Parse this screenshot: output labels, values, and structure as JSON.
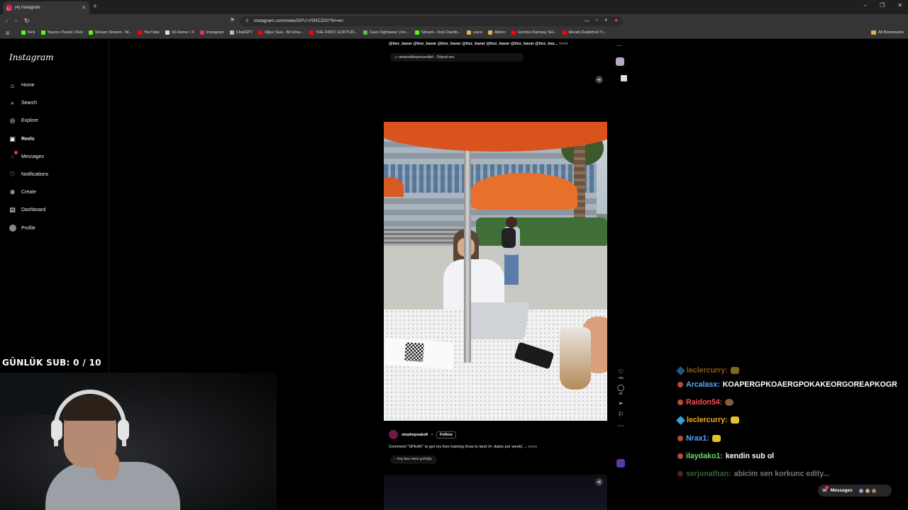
{
  "browser": {
    "tab_title": "(4) Instagram",
    "new_tab_glyph": "+",
    "url": "instagram.com/reels/DPU-VSRCZtX/?hl=en",
    "window_controls": [
      "–",
      "❐",
      "✕"
    ],
    "bookmarks": [
      {
        "label": "Kick",
        "color": "#53fc18"
      },
      {
        "label": "Yayıncı Paneli | Kick",
        "color": "#53fc18"
      },
      {
        "label": "İkinsan Stream - W...",
        "color": "#53fc18"
      },
      {
        "label": "YouTube",
        "color": "#ff0000"
      },
      {
        "label": "(4) Home / X",
        "color": "#dddddd"
      },
      {
        "label": "Instagram",
        "color": "#e1306c"
      },
      {
        "label": "ChatGPT",
        "color": "#bbbbbb"
      },
      {
        "label": "Oğuz Sasi - Bir Efsa...",
        "color": "#ff0000"
      },
      {
        "label": "THE FIRST GOKTUR...",
        "color": "#ff0000"
      },
      {
        "label": "Cave Fightwear | Ins...",
        "color": "#53c24a"
      },
      {
        "label": "Stream - Kick Dashb...",
        "color": "#53fc18"
      },
      {
        "label": "yayın",
        "color": "#e0b050"
      },
      {
        "label": "Albüm",
        "color": "#e0b050"
      },
      {
        "label": "Gordon Ramsay SH...",
        "color": "#ff0000"
      },
      {
        "label": "Merab Dvalishvili Tr...",
        "color": "#ff0000"
      }
    ],
    "all_bookmarks": "All Bookmarks"
  },
  "instagram": {
    "logo": "Instagram",
    "nav": [
      {
        "label": "Home",
        "icon": "home-icon",
        "glyph": "⌂"
      },
      {
        "label": "Search",
        "icon": "search-icon",
        "glyph": "⌕"
      },
      {
        "label": "Explore",
        "icon": "compass-icon",
        "glyph": "◎"
      },
      {
        "label": "Reels",
        "icon": "reels-icon",
        "glyph": "▣"
      },
      {
        "label": "Messages",
        "icon": "messenger-icon",
        "glyph": "◌"
      },
      {
        "label": "Notifications",
        "icon": "heart-icon",
        "glyph": "♡"
      },
      {
        "label": "Create",
        "icon": "plus-square-icon",
        "glyph": "⊕"
      },
      {
        "label": "Dashboard",
        "icon": "dashboard-icon",
        "glyph": "▤"
      },
      {
        "label": "Profile",
        "icon": "profile-avatar-icon",
        "glyph": ""
      }
    ],
    "active_nav": "Reels"
  },
  "reel_previous": {
    "caption": "@tioz_bazar @tioz_bazar @tioz_bazar @tioz_bazar @tioz_bazar @tioz_bazar @tioz_baz...",
    "more": "more",
    "audio": "♫ campoalidepressedkid · Orijinal ses"
  },
  "reel_current": {
    "likes": "700",
    "comments": "20",
    "username": "stephspeaks8",
    "separator": "•",
    "follow": "Follow",
    "caption": "Comment \"SPEAK\" to get my free training (how to land 3+ dates per week) ...",
    "more": "more",
    "audio": "◦◦ Ray-Ban Meta gözlüğü"
  },
  "overlay": {
    "sub_counter": "GÜNLÜK SUB: 0 / 10"
  },
  "chat": [
    {
      "user": "leclercurry:",
      "color": "#f5a623",
      "message": "",
      "emote": true
    },
    {
      "user": "Arcalasx:",
      "color": "#5aa8ff",
      "message": "KOAPERGPKOAERGPOKAKEORGOREAPKOGR",
      "emote": false
    },
    {
      "user": "Raidon54:",
      "color": "#ff4d4d",
      "message": "",
      "emote": true
    },
    {
      "user": "leclercurry:",
      "color": "#f5a623",
      "message": "",
      "emote": true
    },
    {
      "user": "Nrax1:",
      "color": "#5aa8ff",
      "message": "",
      "emote": true
    },
    {
      "user": "ilaydako1:",
      "color": "#6fdc6f",
      "message": "kendin sub ol",
      "emote": false
    },
    {
      "user": "serjonathan:",
      "color": "#6fdc6f",
      "message": "abicim sen korkunc edity...",
      "emote": false
    }
  ],
  "messages_pill": {
    "label": "Messages"
  }
}
